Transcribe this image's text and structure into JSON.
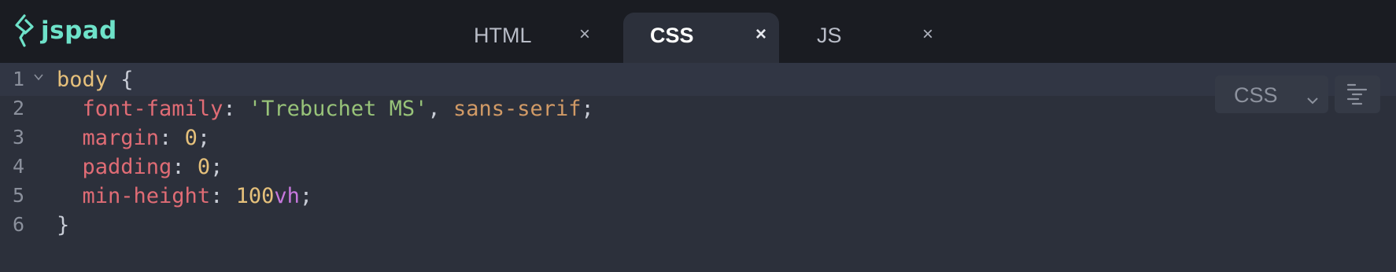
{
  "app": {
    "logo_text": "jspad",
    "brand_color": "#6ee2c9"
  },
  "tabs": [
    {
      "label": "HTML",
      "close": "×"
    },
    {
      "label": "CSS",
      "close": "×",
      "active": true
    },
    {
      "label": "JS",
      "close": "×"
    }
  ],
  "editor": {
    "language_select": {
      "value": "CSS"
    },
    "format_button_icon": "format-code-icon",
    "lines": [
      {
        "n": "1",
        "tokens": [
          [
            "sel",
            "body"
          ],
          [
            "punc",
            " {"
          ]
        ]
      },
      {
        "n": "2",
        "tokens": [
          [
            "punc",
            "  "
          ],
          [
            "prop",
            "font-family"
          ],
          [
            "punc",
            ": "
          ],
          [
            "str",
            "'Trebuchet MS'"
          ],
          [
            "punc",
            ", "
          ],
          [
            "kw",
            "sans-serif"
          ],
          [
            "punc",
            ";"
          ]
        ]
      },
      {
        "n": "3",
        "tokens": [
          [
            "punc",
            "  "
          ],
          [
            "prop",
            "margin"
          ],
          [
            "punc",
            ": "
          ],
          [
            "num",
            "0"
          ],
          [
            "punc",
            ";"
          ]
        ]
      },
      {
        "n": "4",
        "tokens": [
          [
            "punc",
            "  "
          ],
          [
            "prop",
            "padding"
          ],
          [
            "punc",
            ": "
          ],
          [
            "num",
            "0"
          ],
          [
            "punc",
            ";"
          ]
        ]
      },
      {
        "n": "5",
        "tokens": [
          [
            "punc",
            "  "
          ],
          [
            "prop",
            "min-height"
          ],
          [
            "punc",
            ": "
          ],
          [
            "num",
            "100"
          ],
          [
            "unit",
            "vh"
          ],
          [
            "punc",
            ";"
          ]
        ]
      },
      {
        "n": "6",
        "tokens": [
          [
            "punc",
            "}"
          ]
        ]
      }
    ]
  }
}
